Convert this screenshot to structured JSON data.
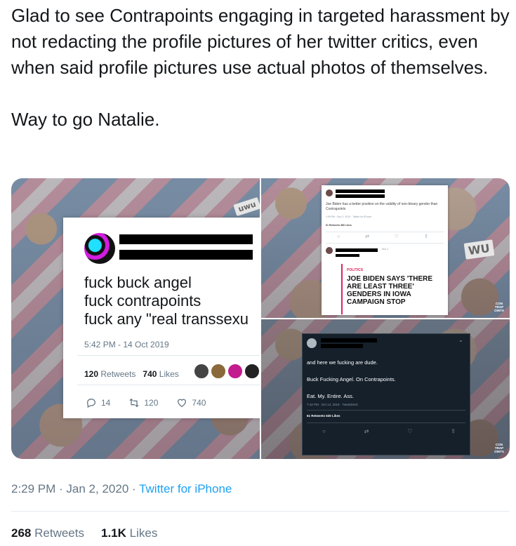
{
  "tweet": {
    "text": "Glad to see Contrapoints engaging in targeted harassment by not redacting the profile pictures of her twitter critics, even when said profile pictures use actual photos of themselves.\n\nWay to go Natalie."
  },
  "media": {
    "left": {
      "uwu_tag": "uwu",
      "quote_text": "fuck buck angel\nfuck contrapoints\nfuck any \"real transsexu",
      "timestamp": "5:42 PM - 14 Oct 2019",
      "retweets_count": "120",
      "retweets_label": "Retweets",
      "likes_count": "740",
      "likes_label": "Likes",
      "reply_count": "14",
      "retweet_action_count": "120",
      "like_action_count": "740"
    },
    "top_right": {
      "body": "Joe Biden has a better position on the validity of non-binary gender than Contrapoints",
      "meta": "1:59 PM · Nov 2, 2019 · Twitter for iPhone",
      "stats": "61 Retweets   580 Likes",
      "reply_date": "Nov 2",
      "news_category": "POLITICS",
      "news_headline": "JOE BIDEN SAYS 'THERE ARE LEAST THREE' GENDERS IN IOWA CAMPAIGN STOP",
      "uwu_tag": "WU",
      "logo_text": "CON TRAP OINTS"
    },
    "bottom_right": {
      "line1": "and here we fucking are dude.",
      "line2": "Buck Fucking Angel. On Contrapoints.",
      "line3": "Eat. My. Entire. Ass.",
      "meta": "7:42 PM · Oct 14, 2019 · TweetDeck",
      "stats": "61 Retweets   630 Likes",
      "logo_text": "CON TRAP OINTS"
    }
  },
  "meta": {
    "time": "2:29 PM · Jan 2, 2020 · ",
    "source": "Twitter for iPhone"
  },
  "counts": {
    "retweets_count": "268",
    "retweets_label": "Retweets",
    "likes_count": "1.1K",
    "likes_label": "Likes"
  },
  "colors": {
    "text": "#14171a",
    "secondary": "#657786",
    "link": "#1da1f2",
    "dark_card": "#15202b"
  }
}
